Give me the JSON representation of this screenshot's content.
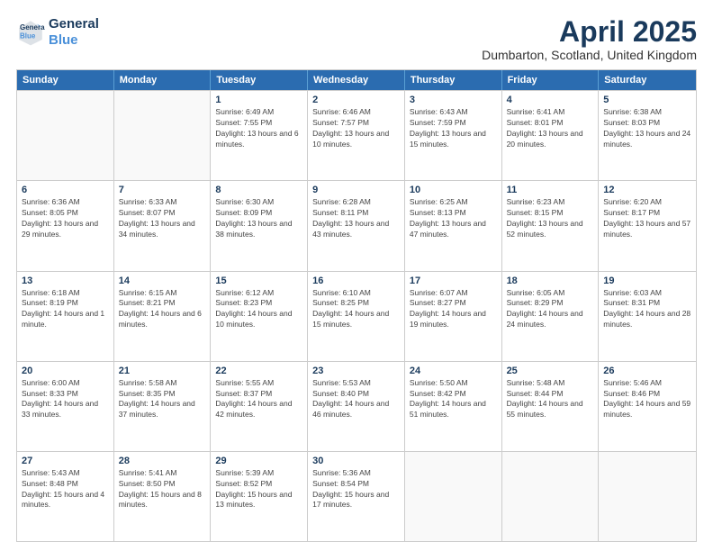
{
  "header": {
    "logo_line1": "General",
    "logo_line2": "Blue",
    "title": "April 2025",
    "location": "Dumbarton, Scotland, United Kingdom"
  },
  "calendar": {
    "days_of_week": [
      "Sunday",
      "Monday",
      "Tuesday",
      "Wednesday",
      "Thursday",
      "Friday",
      "Saturday"
    ],
    "weeks": [
      [
        {
          "day": "",
          "info": "",
          "empty": true
        },
        {
          "day": "",
          "info": "",
          "empty": true
        },
        {
          "day": "1",
          "info": "Sunrise: 6:49 AM\nSunset: 7:55 PM\nDaylight: 13 hours and 6 minutes."
        },
        {
          "day": "2",
          "info": "Sunrise: 6:46 AM\nSunset: 7:57 PM\nDaylight: 13 hours and 10 minutes."
        },
        {
          "day": "3",
          "info": "Sunrise: 6:43 AM\nSunset: 7:59 PM\nDaylight: 13 hours and 15 minutes."
        },
        {
          "day": "4",
          "info": "Sunrise: 6:41 AM\nSunset: 8:01 PM\nDaylight: 13 hours and 20 minutes."
        },
        {
          "day": "5",
          "info": "Sunrise: 6:38 AM\nSunset: 8:03 PM\nDaylight: 13 hours and 24 minutes."
        }
      ],
      [
        {
          "day": "6",
          "info": "Sunrise: 6:36 AM\nSunset: 8:05 PM\nDaylight: 13 hours and 29 minutes."
        },
        {
          "day": "7",
          "info": "Sunrise: 6:33 AM\nSunset: 8:07 PM\nDaylight: 13 hours and 34 minutes."
        },
        {
          "day": "8",
          "info": "Sunrise: 6:30 AM\nSunset: 8:09 PM\nDaylight: 13 hours and 38 minutes."
        },
        {
          "day": "9",
          "info": "Sunrise: 6:28 AM\nSunset: 8:11 PM\nDaylight: 13 hours and 43 minutes."
        },
        {
          "day": "10",
          "info": "Sunrise: 6:25 AM\nSunset: 8:13 PM\nDaylight: 13 hours and 47 minutes."
        },
        {
          "day": "11",
          "info": "Sunrise: 6:23 AM\nSunset: 8:15 PM\nDaylight: 13 hours and 52 minutes."
        },
        {
          "day": "12",
          "info": "Sunrise: 6:20 AM\nSunset: 8:17 PM\nDaylight: 13 hours and 57 minutes."
        }
      ],
      [
        {
          "day": "13",
          "info": "Sunrise: 6:18 AM\nSunset: 8:19 PM\nDaylight: 14 hours and 1 minute."
        },
        {
          "day": "14",
          "info": "Sunrise: 6:15 AM\nSunset: 8:21 PM\nDaylight: 14 hours and 6 minutes."
        },
        {
          "day": "15",
          "info": "Sunrise: 6:12 AM\nSunset: 8:23 PM\nDaylight: 14 hours and 10 minutes."
        },
        {
          "day": "16",
          "info": "Sunrise: 6:10 AM\nSunset: 8:25 PM\nDaylight: 14 hours and 15 minutes."
        },
        {
          "day": "17",
          "info": "Sunrise: 6:07 AM\nSunset: 8:27 PM\nDaylight: 14 hours and 19 minutes."
        },
        {
          "day": "18",
          "info": "Sunrise: 6:05 AM\nSunset: 8:29 PM\nDaylight: 14 hours and 24 minutes."
        },
        {
          "day": "19",
          "info": "Sunrise: 6:03 AM\nSunset: 8:31 PM\nDaylight: 14 hours and 28 minutes."
        }
      ],
      [
        {
          "day": "20",
          "info": "Sunrise: 6:00 AM\nSunset: 8:33 PM\nDaylight: 14 hours and 33 minutes."
        },
        {
          "day": "21",
          "info": "Sunrise: 5:58 AM\nSunset: 8:35 PM\nDaylight: 14 hours and 37 minutes."
        },
        {
          "day": "22",
          "info": "Sunrise: 5:55 AM\nSunset: 8:37 PM\nDaylight: 14 hours and 42 minutes."
        },
        {
          "day": "23",
          "info": "Sunrise: 5:53 AM\nSunset: 8:40 PM\nDaylight: 14 hours and 46 minutes."
        },
        {
          "day": "24",
          "info": "Sunrise: 5:50 AM\nSunset: 8:42 PM\nDaylight: 14 hours and 51 minutes."
        },
        {
          "day": "25",
          "info": "Sunrise: 5:48 AM\nSunset: 8:44 PM\nDaylight: 14 hours and 55 minutes."
        },
        {
          "day": "26",
          "info": "Sunrise: 5:46 AM\nSunset: 8:46 PM\nDaylight: 14 hours and 59 minutes."
        }
      ],
      [
        {
          "day": "27",
          "info": "Sunrise: 5:43 AM\nSunset: 8:48 PM\nDaylight: 15 hours and 4 minutes."
        },
        {
          "day": "28",
          "info": "Sunrise: 5:41 AM\nSunset: 8:50 PM\nDaylight: 15 hours and 8 minutes."
        },
        {
          "day": "29",
          "info": "Sunrise: 5:39 AM\nSunset: 8:52 PM\nDaylight: 15 hours and 13 minutes."
        },
        {
          "day": "30",
          "info": "Sunrise: 5:36 AM\nSunset: 8:54 PM\nDaylight: 15 hours and 17 minutes."
        },
        {
          "day": "",
          "info": "",
          "empty": true
        },
        {
          "day": "",
          "info": "",
          "empty": true
        },
        {
          "day": "",
          "info": "",
          "empty": true
        }
      ]
    ]
  }
}
